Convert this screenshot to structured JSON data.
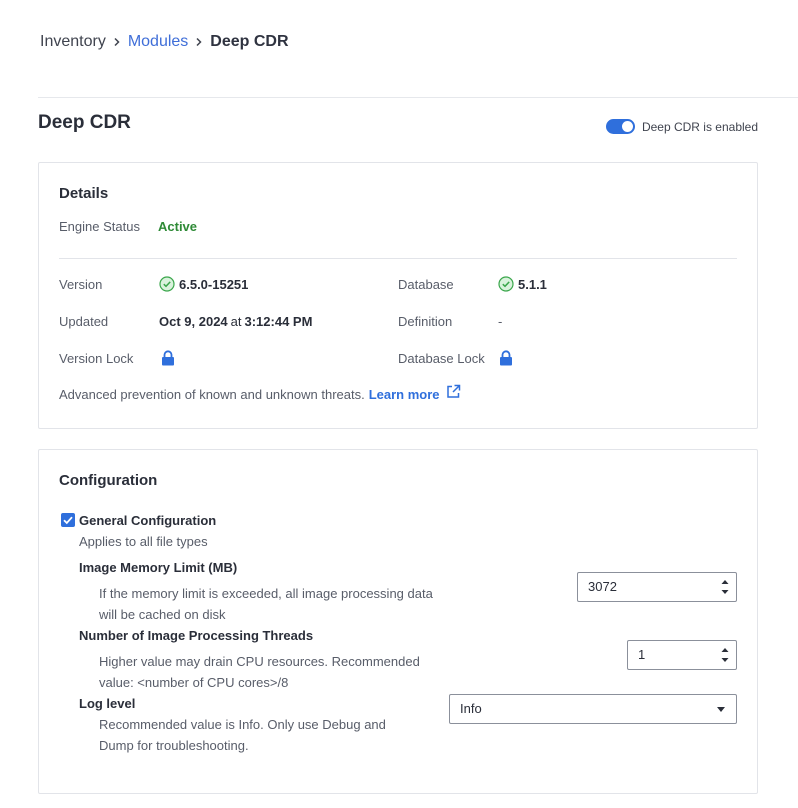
{
  "breadcrumb": {
    "items": [
      {
        "label": "Inventory"
      },
      {
        "label": "Modules"
      },
      {
        "label": "Deep CDR"
      }
    ],
    "separator": ">"
  },
  "page": {
    "title": "Deep CDR",
    "toggle": {
      "label": "Deep CDR is enabled",
      "state": "on"
    }
  },
  "details": {
    "title": "Details",
    "engine_status_label": "Engine Status",
    "engine_status_value": "Active",
    "version_label": "Version",
    "version_value": "6.5.0-15251",
    "database_label": "Database",
    "database_value": "5.1.1",
    "updated_label": "Updated",
    "updated_date": "Oct 9, 2024",
    "updated_at": "at",
    "updated_time": "3:12:44 PM",
    "definition_label": "Definition",
    "definition_value": "-",
    "version_lock_label": "Version Lock",
    "database_lock_label": "Database Lock",
    "description": "Advanced prevention of known and unknown threats.",
    "learn_more": "Learn more"
  },
  "configuration": {
    "title": "Configuration",
    "general": {
      "label": "General Configuration",
      "checked": true,
      "subtitle": "Applies to all file types"
    },
    "memory": {
      "title": "Image Memory Limit (MB)",
      "help_line1": "If the memory limit is exceeded, all image processing data",
      "help_line2": "will be cached on disk",
      "value": "3072"
    },
    "threads": {
      "title": "Number of Image Processing Threads",
      "help_line1": "Higher value may drain CPU resources. Recommended",
      "help_line2": "value: <number of CPU cores>/8",
      "value": "1"
    },
    "log": {
      "title": "Log level",
      "help_line1": "Recommended value is Info. Only use Debug and",
      "help_line2": "Dump for troubleshooting.",
      "value": "Info"
    }
  },
  "colors": {
    "accent": "#2f6fdc",
    "link": "#3f6ed8",
    "active_status": "#2e8a36",
    "check_green": "#3aa64b"
  },
  "icons": [
    "chevron-right-icon",
    "toggle-switch",
    "check-circle-icon",
    "lock-icon",
    "external-link-icon",
    "checkbox-checked-icon",
    "spinner-arrows-icon",
    "caret-down-icon"
  ]
}
